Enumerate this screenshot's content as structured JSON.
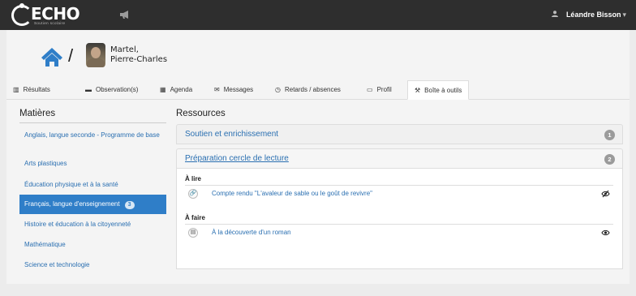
{
  "header": {
    "logo_text": "ECHO",
    "logo_tagline": "Soutien scolaire",
    "user_name": "Léandre Bisson",
    "user_icon": "user-icon",
    "announce_icon": "megaphone-icon"
  },
  "student": {
    "name_line1": "Martel,",
    "name_line2": "Pierre-Charles",
    "home_icon": "home-icon",
    "separator": "/"
  },
  "tabs": [
    {
      "label": "Résultats",
      "icon": "bar-chart-icon",
      "active": false
    },
    {
      "label": "Observation(s)",
      "icon": "folder-icon",
      "active": false
    },
    {
      "label": "Agenda",
      "icon": "calendar-icon",
      "active": false
    },
    {
      "label": "Messages",
      "icon": "envelope-icon",
      "active": false
    },
    {
      "label": "Retards / absences",
      "icon": "clock-icon",
      "active": false
    },
    {
      "label": "Profil",
      "icon": "id-card-icon",
      "active": false
    },
    {
      "label": "Boîte à outils",
      "icon": "tools-icon",
      "active": true
    }
  ],
  "left": {
    "title": "Matières",
    "items": [
      {
        "label": "Anglais, langue seconde - Programme de base"
      },
      {
        "label": "Arts plastiques"
      },
      {
        "label": "Éducation physique et à la santé"
      },
      {
        "label": "Français, langue d'enseignement",
        "badge": "3",
        "active": true
      },
      {
        "label": "Histoire et éducation à la citoyenneté"
      },
      {
        "label": "Mathématique"
      },
      {
        "label": "Science et technologie"
      }
    ]
  },
  "right": {
    "title": "Ressources",
    "groups": [
      {
        "label": "Soutien et enrichissement",
        "count": "1"
      },
      {
        "label": "Préparation cercle de lecture",
        "count": "2"
      }
    ],
    "sections": [
      {
        "title": "À lire",
        "item": "Compte rendu \"L'avaleur de sable ou le goût de revivre\"",
        "item_icon": "link-icon",
        "status_icon": "eye-slash-icon"
      },
      {
        "title": "À faire",
        "item": "À la découverte d'un roman",
        "item_icon": "document-icon",
        "status_icon": "eye-icon"
      }
    ]
  },
  "colors": {
    "topbar": "#2e2e2e",
    "accent": "#2f7ec8",
    "link": "#2a6fb1",
    "badge": "#9b9b9b"
  }
}
